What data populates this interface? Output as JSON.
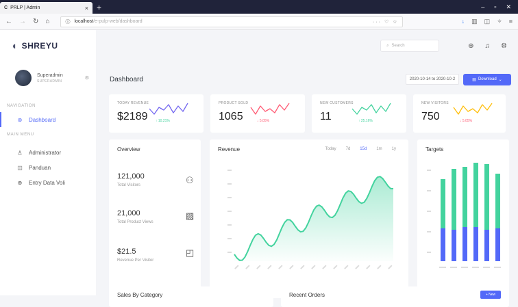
{
  "browser": {
    "tab_title": "PRLP | Admin",
    "new_tab": "+",
    "url_host": "localhost",
    "url_path": "/e-pulp-web/dashboard",
    "win_min": "–",
    "win_max": "▫",
    "win_close": "✕"
  },
  "brand": {
    "name": "SHREYU"
  },
  "user": {
    "name": "Superadmin",
    "role": "SUPERADMIN"
  },
  "nav": {
    "section1": "NAVIGATION",
    "dashboard": "Dashboard",
    "section2": "MAIN MENU",
    "items": [
      "Administrator",
      "Panduan",
      "Entry Data Voli"
    ]
  },
  "topbar": {
    "search_placeholder": "Search"
  },
  "page": {
    "title": "Dashboard",
    "date_range": "2020-10-14 to 2020-10-2",
    "download_label": "Download"
  },
  "stats": [
    {
      "label": "TODAY REVENUE",
      "value": "$2189",
      "change": "↑ 10.21%",
      "color": "#7367f0",
      "dir": "up"
    },
    {
      "label": "PRODUCT SOLD",
      "value": "1065",
      "change": "↓ 5.05%",
      "color": "#ff5c75",
      "dir": "down"
    },
    {
      "label": "NEW CUSTOMERS",
      "value": "11",
      "change": "↑ 25.16%",
      "color": "#43d39e",
      "dir": "up"
    },
    {
      "label": "NEW VISITORS",
      "value": "750",
      "change": "↓ 5.05%",
      "color": "#ffbe0b",
      "dir": "down"
    }
  ],
  "overview": {
    "title": "Overview",
    "items": [
      {
        "value": "121,000",
        "label": "Total Visitors",
        "icon": "users-icon"
      },
      {
        "value": "21,000",
        "label": "Total Product Views",
        "icon": "image-icon"
      },
      {
        "value": "$21.5",
        "label": "Revenue Per Visitor",
        "icon": "shopping-bag-icon"
      }
    ]
  },
  "revenue": {
    "title": "Revenue",
    "periods": [
      "Today",
      "7d",
      "15d",
      "1m",
      "1y"
    ],
    "active_period": "15d"
  },
  "targets": {
    "title": "Targets"
  },
  "bottom": {
    "sales_title": "Sales By Category",
    "orders_title": "Recent Orders",
    "new_label": "+ New"
  },
  "colors": {
    "primary": "#5369f8",
    "success": "#43d39e",
    "danger": "#ff5c75",
    "warning": "#ffbe0b"
  }
}
